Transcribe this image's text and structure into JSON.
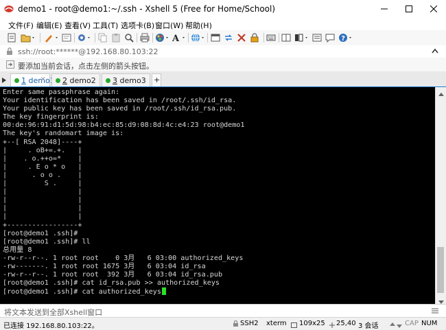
{
  "window": {
    "title": "demo1 - root@demo1:~/.ssh - Xshell 5 (Free for Home/School)"
  },
  "menu": [
    "文件(F)",
    "编辑(E)",
    "查看(V)",
    "工具(T)",
    "选项卡(B)",
    "窗口(W)",
    "帮助(H)"
  ],
  "address": {
    "value": "ssh://root:******@192.168.80.103:22"
  },
  "hint": {
    "text": "要添加当前会话，点击左侧的箭头按钮。"
  },
  "tabs": [
    {
      "num": "1",
      "name": "demo1",
      "active": true
    },
    {
      "num": "2",
      "name": "demo2",
      "active": false
    },
    {
      "num": "3",
      "name": "demo3",
      "active": false
    }
  ],
  "tab_close": "×",
  "tab_add": "+",
  "terminal": {
    "lines": [
      "Enter same passphrase again:",
      "Your identification has been saved in /root/.ssh/id_rsa.",
      "Your public key has been saved in /root/.ssh/id_rsa.pub.",
      "The key fingerprint is:",
      "00:de:96:91:d1:5d:98:b4:ec:85:d9:08:8d:4c:e4:23 root@demo1",
      "The key's randomart image is:",
      "+--[ RSA 2048]----+",
      "|     . oB+=.+.   |",
      "|    . o.++o=*    |",
      "|     . E o * o   |",
      "|      . o o .    |",
      "|         S .     |",
      "|                 |",
      "|                 |",
      "|                 |",
      "|                 |",
      "+-----------------+",
      "[root@demo1 .ssh]#",
      "[root@demo1 .ssh]# ll",
      "总用量 8",
      "-rw-r--r--. 1 root root    0 3月   6 03:00 authorized_keys",
      "-rw-------. 1 root root 1675 3月   6 03:04 id_rsa",
      "-rw-r--r--. 1 root root  392 3月   6 03:04 id_rsa.pub",
      "[root@demo1 .ssh]# cat id_rsa.pub >> authorized_keys"
    ],
    "prompt_line": "[root@demo1 .ssh]# cat authorized_keys"
  },
  "compose": {
    "placeholder": "将文本发送到全部Xshell窗口"
  },
  "status": {
    "connection": "已连接 192.168.80.103:22。",
    "protocol": "SSH2",
    "terminal_type": "xterm",
    "size": "109x25",
    "cursor_pos": "25,40",
    "sessions": "3 会话",
    "caps": "CAP",
    "num": "NUM"
  },
  "icons": [
    "app-icon",
    "new-session-icon",
    "open-session-icon",
    "properties-icon",
    "copy-icon",
    "paste-icon",
    "find-icon",
    "print-icon",
    "font-icon",
    "globe-icon",
    "lock-icon",
    "keyboard-icon",
    "script-icon",
    "chat-icon",
    "help-icon",
    "address-lock-icon",
    "hint-arrow-icon",
    "menu-icon"
  ],
  "colors": {
    "accent": "#1e7fd1",
    "terminal_bg": "#000000",
    "terminal_fg": "#d8d8d8",
    "cursor": "#27e227",
    "tab_dot": "#26a92c"
  }
}
